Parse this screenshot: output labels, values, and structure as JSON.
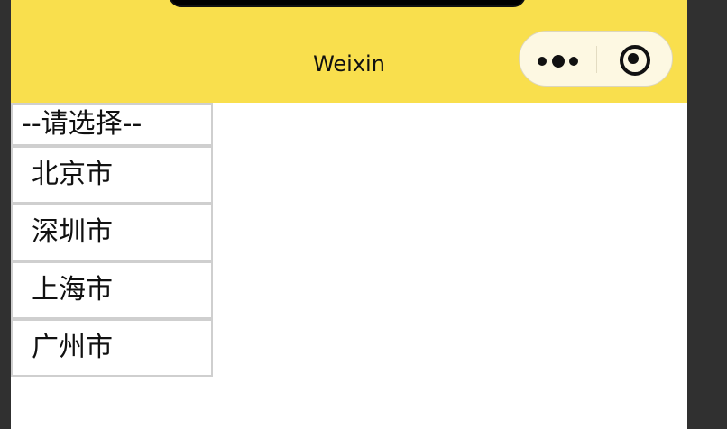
{
  "navbar": {
    "title": "Weixin",
    "more_icon": "more-dots-icon",
    "close_icon": "target-circle-icon",
    "background": "#f9df4d"
  },
  "picker": {
    "placeholder": "--请选择--",
    "options": [
      "北京市",
      "深圳市",
      "上海市",
      "广州市"
    ]
  }
}
